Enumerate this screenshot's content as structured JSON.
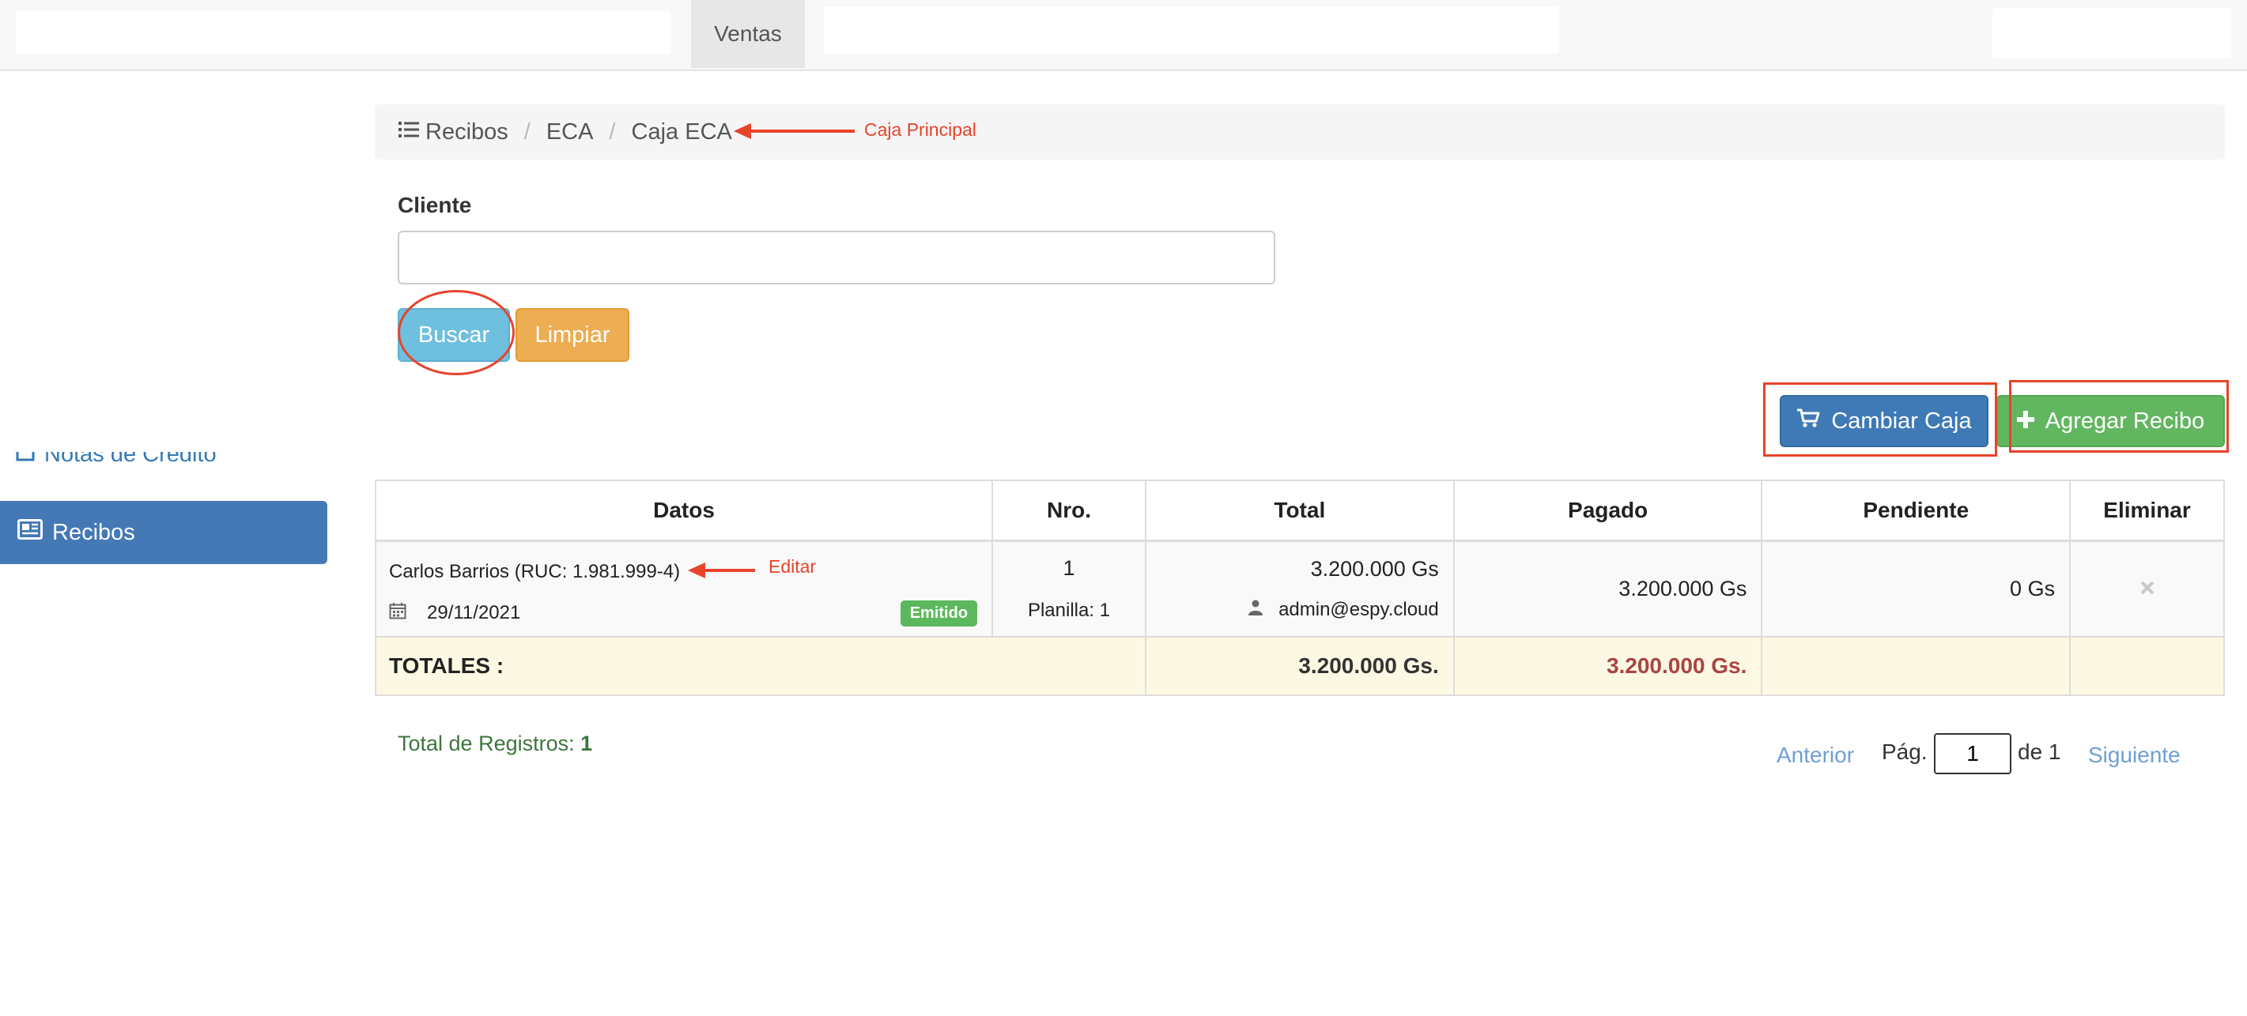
{
  "navbar": {
    "active_tab": "Ventas"
  },
  "sidebar": {
    "partial_item_label": "Notas de Crédito",
    "active_item_label": "Recibos"
  },
  "breadcrumb": {
    "items": [
      "Recibos",
      "ECA",
      "Caja ECA"
    ],
    "annotation": "Caja Principal"
  },
  "form": {
    "cliente_label": "Cliente",
    "cliente_value": "",
    "buscar_label": "Buscar",
    "limpiar_label": "Limpiar"
  },
  "actions": {
    "cambiar_caja_label": "Cambiar Caja",
    "agregar_recibo_label": "Agregar Recibo"
  },
  "table": {
    "columns": [
      "Datos",
      "Nro.",
      "Total",
      "Pagado",
      "Pendiente",
      "Eliminar"
    ],
    "rows": [
      {
        "cliente": "Carlos Barrios (RUC: 1.981.999-4)",
        "fecha": "29/11/2021",
        "estado": "Emitido",
        "nro": "1",
        "planilla": "Planilla: 1",
        "total": "3.200.000 Gs",
        "usuario": "admin@espy.cloud",
        "pagado": "3.200.000 Gs",
        "pendiente": "0 Gs",
        "edit_annotation": "Editar"
      }
    ],
    "totals": {
      "label": "TOTALES :",
      "total": "3.200.000 Gs.",
      "pagado": "3.200.000 Gs."
    }
  },
  "footer": {
    "total_registros_label": "Total de Registros:",
    "total_registros_value": "1",
    "pager": {
      "anterior": "Anterior",
      "pag_label": "Pág.",
      "current_page": "1",
      "of_label": "de 1",
      "siguiente": "Siguiente"
    }
  },
  "colors": {
    "primary": "#4479b6",
    "success": "#63b660",
    "info": "#6fbfde",
    "warning": "#edad52",
    "annotation": "#e8432b"
  },
  "icons": {
    "breadcrumb": "list-icon",
    "sidebar_recibos": "newspaper-icon",
    "cambiar_caja": "cart-icon",
    "agregar_recibo": "plus-icon",
    "fecha": "calendar-icon",
    "usuario": "user-icon",
    "eliminar": "close-icon"
  }
}
